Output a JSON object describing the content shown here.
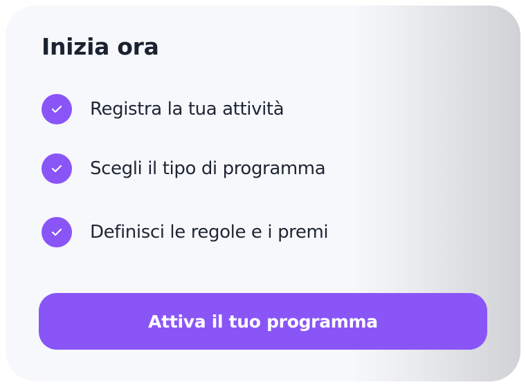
{
  "card": {
    "title": "Inizia ora",
    "checklist": [
      {
        "label": "Registra la tua attività",
        "icon": "check-circle-icon"
      },
      {
        "label": "Scegli il tipo di programma",
        "icon": "check-circle-icon"
      },
      {
        "label": "Definisci le regole e i premi",
        "icon": "check-circle-icon"
      }
    ],
    "cta_label": "Attiva il tuo programma"
  },
  "colors": {
    "accent": "#8a55f7",
    "card_background": "#f6f8fc",
    "text": "#1e2533"
  }
}
